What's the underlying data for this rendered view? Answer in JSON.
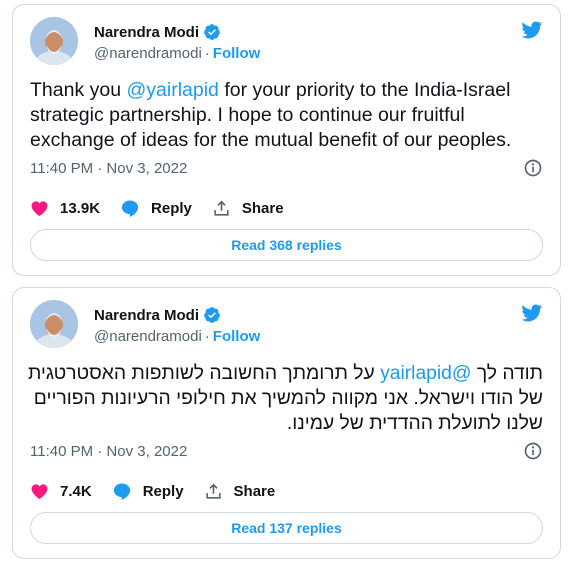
{
  "colors": {
    "accent": "#1d9bf0",
    "like": "#f91880",
    "text": "#0f1419",
    "muted": "#536471"
  },
  "tweets": [
    {
      "author": {
        "name": "Narendra Modi",
        "handle": "@narendramodi",
        "verified": true,
        "follow_label": "Follow",
        "separator": "·"
      },
      "text_parts": {
        "before": "Thank you ",
        "mention": "@yairlapid",
        "after": " for your priority to the India-Israel strategic partnership. I hope to continue our fruitful exchange of ideas for the mutual benefit of our peoples."
      },
      "timestamp": "11:40 PM · Nov 3, 2022",
      "likes": "13.9K",
      "reply_label": "Reply",
      "share_label": "Share",
      "read_replies_label": "Read 368 replies",
      "icons": [
        "twitter-bird-icon",
        "info-icon",
        "heart-icon",
        "reply-bubble-icon",
        "share-icon",
        "verified-badge-icon"
      ]
    },
    {
      "author": {
        "name": "Narendra Modi",
        "handle": "@narendramodi",
        "verified": true,
        "follow_label": "Follow",
        "separator": "·"
      },
      "text_parts": {
        "before": "תודה לך ",
        "mention": "@yairlapid",
        "after": " על תרומתך החשובה לשותפות האסטרטגית של הודו וישראל. אני מקווה להמשיך את חילופי הרעיונות הפוריים שלנו לתועלת ההדדית של עמינו."
      },
      "timestamp": "11:40 PM · Nov 3, 2022",
      "likes": "7.4K",
      "reply_label": "Reply",
      "share_label": "Share",
      "read_replies_label": "Read 137 replies",
      "icons": [
        "twitter-bird-icon",
        "info-icon",
        "heart-icon",
        "reply-bubble-icon",
        "share-icon",
        "verified-badge-icon"
      ]
    }
  ]
}
